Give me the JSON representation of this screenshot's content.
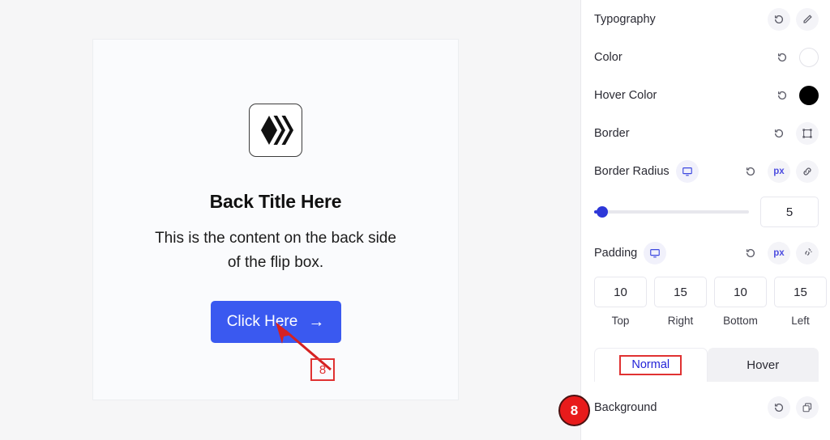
{
  "canvas": {
    "card": {
      "icon_name": "hive-logo-icon",
      "title": "Back Title Here",
      "body": "This is the content on the back side of the flip box.",
      "button": {
        "label": "Click Here",
        "arrow": "→",
        "color": "#3a59f0"
      }
    }
  },
  "panel": {
    "rows": [
      {
        "label": "Typography",
        "reset": "reset-icon",
        "action": "pencil-icon"
      },
      {
        "label": "Color",
        "reset": "reset-icon",
        "swatch": "#ffffff"
      },
      {
        "label": "Hover Color",
        "reset": "reset-icon",
        "swatch": "#000000"
      },
      {
        "label": "Border",
        "reset": "reset-icon",
        "action": "border-frame-icon"
      }
    ],
    "border_radius": {
      "label": "Border Radius",
      "device_icon": "desktop-icon",
      "reset": "reset-icon",
      "unit": "px",
      "link_icon": "link-icon",
      "slider_value": 5,
      "value": "5"
    },
    "padding": {
      "label": "Padding",
      "device_icon": "desktop-icon",
      "reset": "reset-icon",
      "unit": "px",
      "link_icon": "unlink-icon",
      "fields": [
        {
          "value": "10",
          "label": "Top"
        },
        {
          "value": "15",
          "label": "Right"
        },
        {
          "value": "10",
          "label": "Bottom"
        },
        {
          "value": "15",
          "label": "Left"
        }
      ]
    },
    "tabs": [
      {
        "label": "Normal",
        "active": true
      },
      {
        "label": "Hover",
        "active": false
      }
    ],
    "background": {
      "label": "Background",
      "reset": "reset-icon",
      "copy": "copy-icon"
    }
  },
  "annotations": {
    "step_box": "8",
    "step_badge": "8",
    "accent": "#e03232"
  }
}
